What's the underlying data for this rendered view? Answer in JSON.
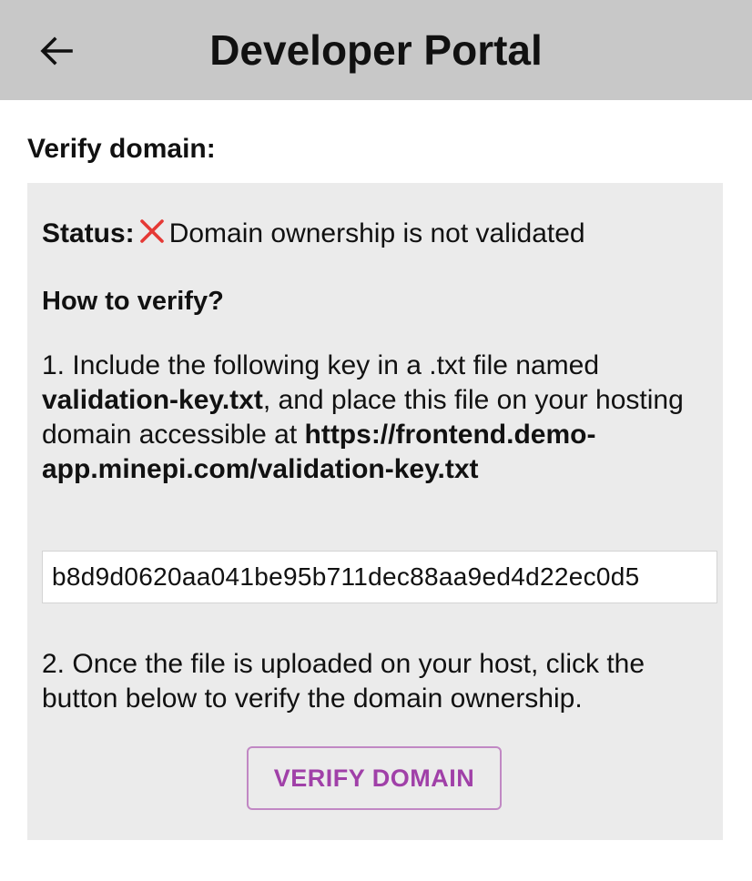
{
  "header": {
    "title": "Developer Portal",
    "back_icon": "arrow-left-icon",
    "background": "#c8c8c8"
  },
  "section": {
    "label": "Verify domain:"
  },
  "status": {
    "label": "Status:",
    "icon": "red-x-icon",
    "icon_color": "#e53935",
    "text": "Domain ownership is not validated"
  },
  "howto": {
    "heading": "How to verify?",
    "step1": {
      "prefix": "1. Include the following key in a .txt file named ",
      "filename": "validation-key.txt",
      "middle": ", and place this file on your hosting domain accessible at ",
      "url": "https://frontend.demo-app.minepi.com/validation-key.txt"
    },
    "key_value": "b8d9d0620aa041be95b711dec88aa9ed4d22ec0d5",
    "step2": "2. Once the file is uploaded on your host, click the button below to verify the domain ownership."
  },
  "actions": {
    "verify_label": "VERIFY DOMAIN",
    "accent": "#a040a8"
  }
}
